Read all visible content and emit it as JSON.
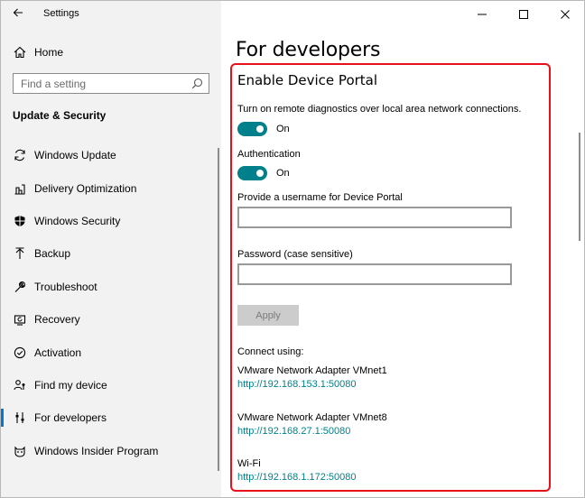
{
  "window": {
    "title": "Settings"
  },
  "sidebar": {
    "home_label": "Home",
    "search_placeholder": "Find a setting",
    "section_title": "Update & Security",
    "items": [
      {
        "label": "Windows Update",
        "icon": "refresh-icon"
      },
      {
        "label": "Delivery Optimization",
        "icon": "delivery-optimization-icon"
      },
      {
        "label": "Windows Security",
        "icon": "shield-icon"
      },
      {
        "label": "Backup",
        "icon": "backup-arrow-icon"
      },
      {
        "label": "Troubleshoot",
        "icon": "wrench-icon"
      },
      {
        "label": "Recovery",
        "icon": "recovery-icon"
      },
      {
        "label": "Activation",
        "icon": "check-circle-icon"
      },
      {
        "label": "Find my device",
        "icon": "person-pin-icon"
      },
      {
        "label": "For developers",
        "icon": "developer-sliders-icon",
        "selected": true
      },
      {
        "label": "Windows Insider Program",
        "icon": "insider-cat-icon"
      }
    ]
  },
  "main": {
    "page_title": "For developers",
    "section_title": "Enable Device Portal",
    "remote_diag_desc": "Turn on remote diagnostics over local area network connections.",
    "remote_toggle_state": "On",
    "auth_label": "Authentication",
    "auth_toggle_state": "On",
    "username_label": "Provide a username for Device Portal",
    "username_value": "",
    "password_label": "Password (case sensitive)",
    "password_value": "",
    "apply_label": "Apply",
    "connect_label": "Connect using:",
    "adapters": [
      {
        "name": "VMware Network Adapter VMnet1",
        "url": "http://192.168.153.1:50080"
      },
      {
        "name": "VMware Network Adapter VMnet8",
        "url": "http://192.168.27.1:50080"
      },
      {
        "name": "Wi-Fi",
        "url": "http://192.168.1.172:50080"
      }
    ]
  },
  "colors": {
    "accent_blue": "#0078d7",
    "toggle_teal": "#00808a",
    "highlight_red": "#e8101a"
  }
}
